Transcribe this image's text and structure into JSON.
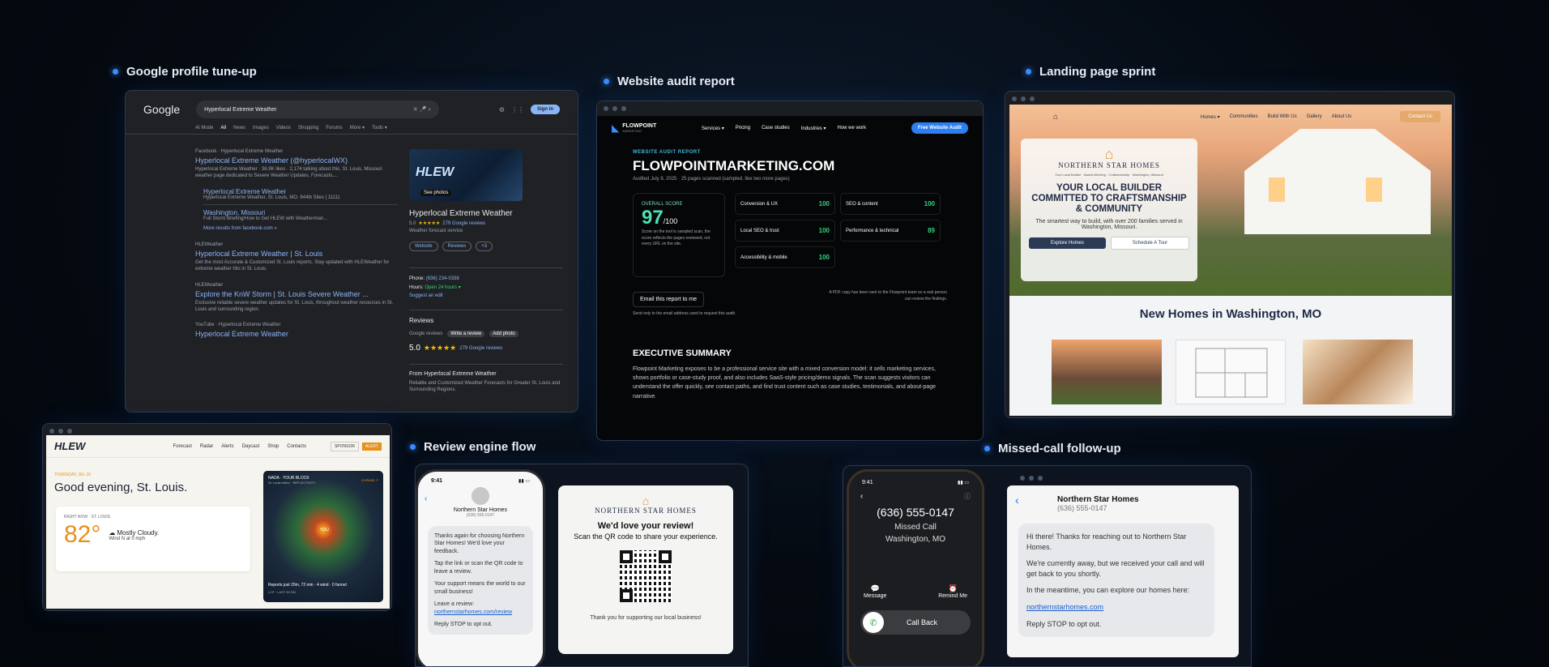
{
  "labels": {
    "google": "Google profile tune-up",
    "audit": "Website audit report",
    "landing": "Landing page sprint",
    "review": "Review engine flow",
    "missed": "Missed-call follow-up"
  },
  "google": {
    "logo": "Google",
    "query": "Hyperlocal Extreme Weather",
    "signin": "Sign in",
    "tabs": [
      "AI Mode",
      "All",
      "News",
      "Images",
      "Videos",
      "Shopping",
      "Forums",
      "More ▾",
      "Tools ▾"
    ],
    "results": [
      {
        "source": "Facebook · Hyperlocal Extreme Weather",
        "title": "Hyperlocal Extreme Weather (@hyperlocalWX)",
        "snippet": "Hyperlocal Extreme Weather · 36.9K likes · 2,174 talking about this. St. Louis, Missouri weather page dedicated to Severe Weather Updates, Forecasts,..."
      },
      {
        "source": "HLEWeather",
        "title": "Hyperlocal Extreme Weather | St. Louis",
        "snippet": "Get the most Accurate & Customized St. Louis reports. Stay updated with HLEWeather for extreme weather hits in St. Louis."
      },
      {
        "source": "HLEWeather",
        "title": "Explore the KnW Storm | St. Louis Severe Weather ...",
        "snippet": "Exclusive reliable severe weather updates for St. Louis, throughout weather resources in St. Louis and surrounding region."
      },
      {
        "source": "YouTube · Hyperlocal Extreme Weather",
        "title": "Hyperlocal Extreme Weather",
        "snippet": ""
      }
    ],
    "sublinks": [
      {
        "title": "Hyperlocal Extreme Weather",
        "desc": "Hyperlocal Extreme Weather, St. Louis, MO. 944lb Sites | 11111"
      },
      {
        "title": "Washington, Missouri",
        "desc": "Full Storm Briefing/How to Get HLEW with Weatherman..."
      }
    ],
    "more_results": "More results from facebook.com »",
    "kp": {
      "img_label": "See photos",
      "logo": "HLEW",
      "title": "Hyperlocal Extreme Weather",
      "rating": "5.0",
      "reviews_count": "279 Google reviews",
      "category": "Weather forecast service",
      "btn_website": "Website",
      "btn_reviews": "Reviews",
      "btn_more": "+3",
      "phone_label": "Phone:",
      "phone": "(636) 234-0338",
      "hours_label": "Hours:",
      "hours": "Open 24 hours ▾",
      "suggest": "Suggest an edit",
      "reviews_heading": "Reviews",
      "google_reviews": "Google reviews",
      "write_review": "Write a review",
      "add_photo": "Add photo",
      "big_rating": "5.0",
      "big_reviews": "279 Google reviews",
      "from_heading": "From Hyperlocal Extreme Weather",
      "from_text": "Reliable and Customized Weather Forecasts for Greater St. Louis and Surrounding Regions."
    }
  },
  "audit": {
    "brand": "FLOWPOINT",
    "brand_sub": "MARKETING",
    "nav": [
      "Services ▾",
      "Pricing",
      "Case studies",
      "Industries ▾",
      "How we work"
    ],
    "cta": "Free Website Audit",
    "eyebrow": "WEBSITE AUDIT REPORT",
    "domain": "FLOWPOINTMARKETING.COM",
    "meta": "Audited July 8, 2025 · 25 pages scanned (sampled, like two more pages)",
    "overall_label": "OVERALL SCORE",
    "overall": "97",
    "out_of": "/100",
    "overall_note": "Score on the tool is sampled scan, the score reflects the pages reviewed, not every URL on the site.",
    "scores": [
      {
        "name": "Conversion & UX",
        "val": "100"
      },
      {
        "name": "SEO & content",
        "val": "100"
      },
      {
        "name": "Local SEO & trust",
        "val": "100"
      },
      {
        "name": "Performance & technical",
        "val": "89"
      },
      {
        "name": "Accessibility & mobile",
        "val": "100"
      }
    ],
    "email_btn": "Email this report to me",
    "email_note": "Send only to the email address used to request this audit.",
    "pdf_note": "A PDF copy has been sent to the Flowpoint team so a real person can review the findings.",
    "exec_title": "EXECUTIVE SUMMARY",
    "exec_text": "Flowpoint Marketing exposes to be a professional service site with a mixed conversion model: it sells marketing services, shows portfolio or case-study proof, and also includes SaaS-style pricing/demo signals. The scan suggests visitors can understand the offer quickly, see contact paths, and find trust content such as case studies, testimonials, and about-page narrative."
  },
  "landing": {
    "nav": [
      "Homes ▾",
      "Communities",
      "Build With Us",
      "Gallery",
      "About Us"
    ],
    "contact": "Contact Us",
    "brand": "NORTHERN STAR HOMES",
    "tagline": "Your Local Builder · Award-Winning · Craftsmanship · Washington, Missouri",
    "headline": "YOUR LOCAL BUILDER COMMITTED TO CRAFTSMANSHIP & COMMUNITY",
    "sub": "The smartest way to build, with over 200 families served in Washington, Missouri.",
    "btn1": "Explore Homes",
    "btn2": "Schedule A Tour",
    "section": "New Homes in Washington, MO"
  },
  "weather": {
    "logo": "HLEW",
    "nav": [
      "Forecast",
      "Radar",
      "Alerts",
      "Daycast",
      "Shop",
      "Contacts"
    ],
    "sponsor": "SPONSOR",
    "alert": "ALERT",
    "date": "THURSDAY, JUL 10",
    "greeting": "Good evening, St. Louis.",
    "now_label": "RIGHT NOW · ST. LOUIS",
    "temp": "82°",
    "cond": "Mostly Cloudy.",
    "wind": "Wind N at 0 mph",
    "radar_title": "NADA · YOUR BLOCK",
    "radar_sub": "St. Louis metro · REFLECTIVITY",
    "expand": "EXPAND ↗",
    "you": "YOU",
    "radar_foot": "Reports just 20m, 72 min · 4 wind · 0 funnel",
    "radar_foot2": "LCP · LAST 30 SM"
  },
  "review": {
    "time": "9:41",
    "contact": "Northern Star Homes",
    "phone": "(636) 555-0147",
    "msgs": [
      "Thanks again for choosing Northern Star Homes! We'd love your feedback.",
      "Tap the link or scan the QR code to leave a review.",
      "Your support means the world to our small business!",
      "Leave a review:",
      "Reply STOP to opt out."
    ],
    "link": "northernstarhomes.com/review",
    "card_brand": "NORTHERN STAR HOMES",
    "card_title": "We'd love your review!",
    "card_sub": "Scan the QR code to share your experience.",
    "card_foot": "Thank you for supporting our local business!"
  },
  "missed": {
    "time": "9:41",
    "number": "(636) 555-0147",
    "status": "Missed Call",
    "location": "Washington, MO",
    "message": "Message",
    "remind": "Remind Me",
    "callback": "Call Back",
    "contact": "Northern Star Homes",
    "phone": "(636) 555-0147",
    "msg1": "Hi there! Thanks for reaching out to Northern Star Homes.",
    "msg2": "We're currently away, but we received your call and will get back to you shortly.",
    "msg3": "In the meantime, you can explore our homes here:",
    "link": "northernstarhomes.com",
    "msg4": "Reply STOP to opt out."
  }
}
